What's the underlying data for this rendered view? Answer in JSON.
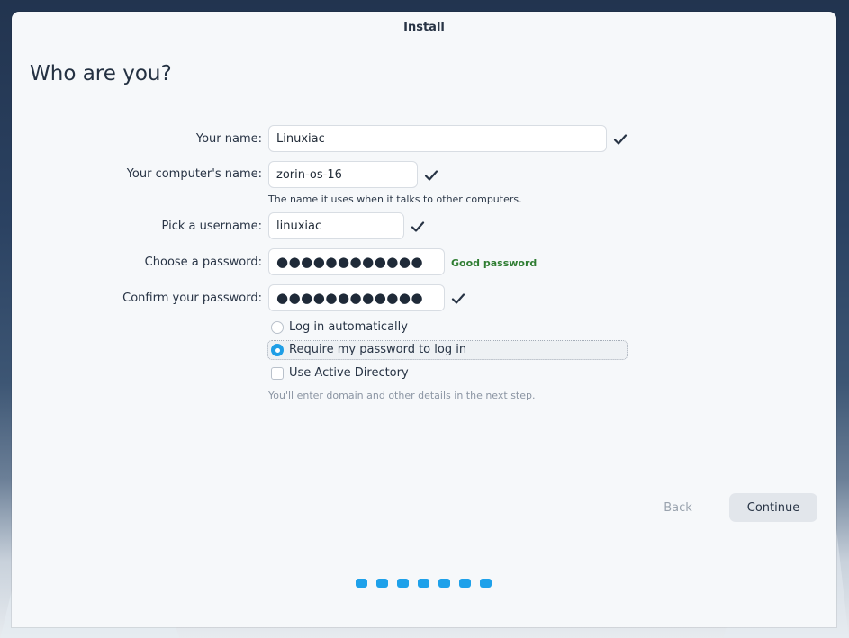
{
  "window": {
    "title": "Install"
  },
  "page": {
    "title": "Who are you?"
  },
  "form": {
    "name": {
      "label": "Your name:",
      "value": "Linuxiac"
    },
    "computer_name": {
      "label": "Your computer's name:",
      "value": "zorin-os-16",
      "hint": "The name it uses when it talks to other computers."
    },
    "username": {
      "label": "Pick a username:",
      "value": "linuxiac"
    },
    "password": {
      "label": "Choose a password:",
      "value": "●●●●●●●●●●●●",
      "strength": "Good password"
    },
    "confirm_password": {
      "label": "Confirm your password:",
      "value": "●●●●●●●●●●●●"
    },
    "login_options": [
      {
        "label": "Log in automatically",
        "checked": false
      },
      {
        "label": "Require my password to log in",
        "checked": true
      }
    ],
    "active_directory": {
      "label": "Use Active Directory",
      "checked": false,
      "hint": "You'll enter domain and other details in the next step."
    }
  },
  "buttons": {
    "back": "Back",
    "continue": "Continue"
  },
  "progress": {
    "total_steps": 7
  },
  "colors": {
    "accent": "#1ea1ea",
    "good_password": "#2f7d32",
    "check_icon": "#283445"
  },
  "icons": {
    "valid": "checkmark-icon"
  }
}
